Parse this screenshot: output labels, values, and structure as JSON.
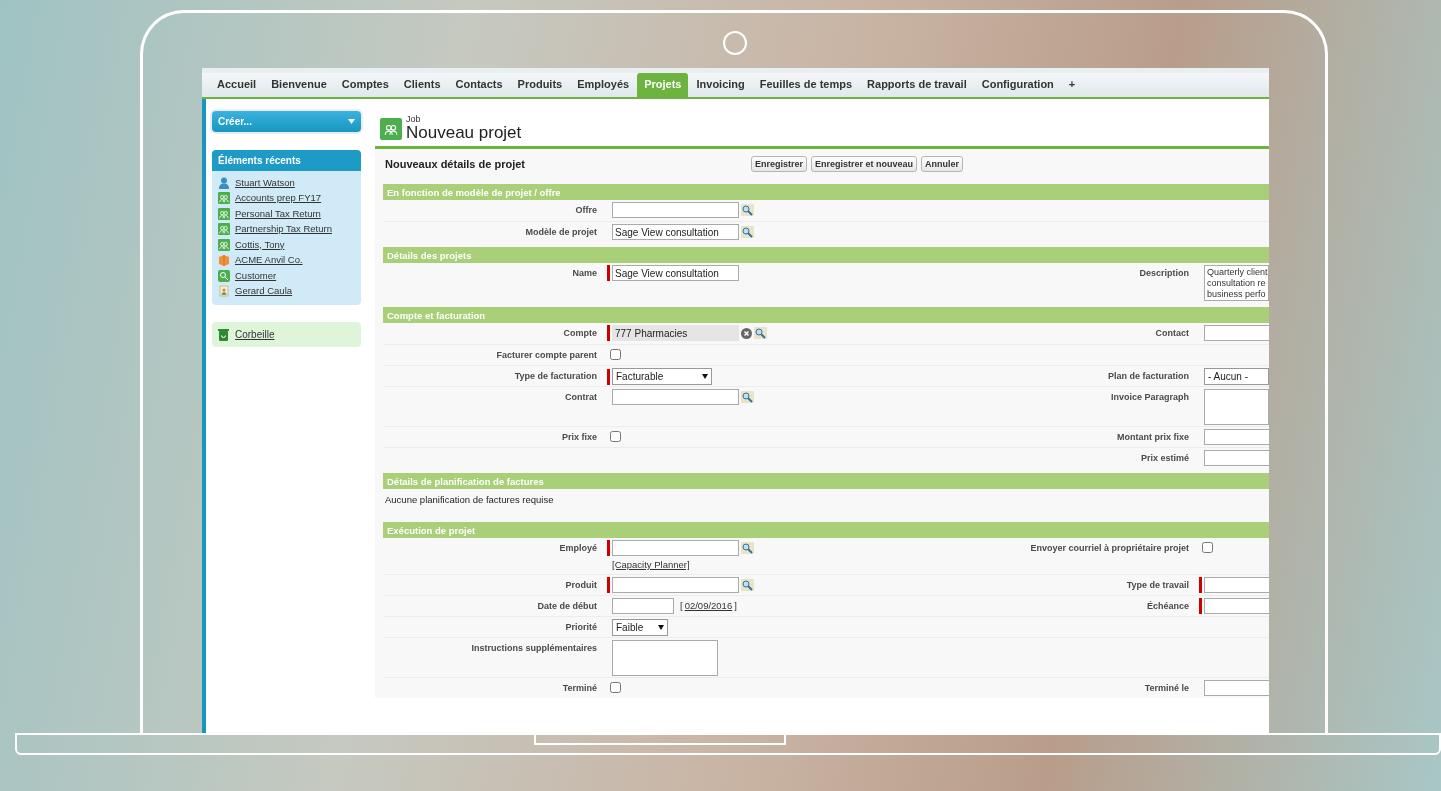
{
  "nav": {
    "tabs": [
      {
        "label": "Accueil",
        "selected": false
      },
      {
        "label": "Bienvenue",
        "selected": false
      },
      {
        "label": "Comptes",
        "selected": false
      },
      {
        "label": "Clients",
        "selected": false
      },
      {
        "label": "Contacts",
        "selected": false
      },
      {
        "label": "Produits",
        "selected": false
      },
      {
        "label": "Employés",
        "selected": false
      },
      {
        "label": "Projets",
        "selected": true
      },
      {
        "label": "Invoicing",
        "selected": false
      },
      {
        "label": "Feuilles de temps",
        "selected": false
      },
      {
        "label": "Rapports de travail",
        "selected": false
      },
      {
        "label": "Configuration",
        "selected": false
      }
    ],
    "add_tab": "+"
  },
  "sidebar": {
    "create_button": "Créer...",
    "recent": {
      "title": "Éléments récents",
      "items": [
        {
          "label": "Stuart Watson",
          "kind": "contact"
        },
        {
          "label": "Accounts prep FY17",
          "kind": "project"
        },
        {
          "label": "Personal Tax Return",
          "kind": "project"
        },
        {
          "label": "Partnership Tax Return",
          "kind": "project"
        },
        {
          "label": "Cottis, Tony",
          "kind": "project"
        },
        {
          "label": "ACME Anvil Co.",
          "kind": "account"
        },
        {
          "label": "Customer",
          "kind": "customer"
        },
        {
          "label": "Gerard Caula",
          "kind": "lead"
        }
      ]
    },
    "recycle_bin": "Corbeille"
  },
  "header": {
    "object": "Job",
    "title": "Nouveau projet"
  },
  "form": {
    "title": "Nouveaux détails de projet",
    "buttons": [
      "Enregistrer",
      "Enregistrer et nouveau",
      "Annuler"
    ],
    "sections": [
      {
        "title": "En fonction de modèle de projet / offre",
        "rows": [
          {
            "left": {
              "label": "Offre",
              "kind": "lookup",
              "required": false
            }
          },
          {
            "left": {
              "label": "Modèle de projet",
              "kind": "lookup",
              "required": false,
              "value": "Sage View consultation"
            }
          }
        ]
      },
      {
        "title": "Détails des projets",
        "rows": [
          {
            "left": {
              "label": "Name",
              "kind": "text",
              "required": true,
              "value": "Sage View consultation"
            },
            "right": {
              "label": "Description",
              "kind": "textarea",
              "required": false,
              "value": "Quarterly client\nconsultation re\nbusiness perfo"
            }
          }
        ]
      },
      {
        "title": "Compte et facturation",
        "rows": [
          {
            "left": {
              "label": "Compte",
              "kind": "locked_lookup",
              "required": true,
              "value": "777 Pharmacies"
            },
            "right": {
              "label": "Contact",
              "kind": "text",
              "required": false
            }
          },
          {
            "left": {
              "label": "Facturer compte parent",
              "kind": "checkbox",
              "checked": false
            }
          },
          {
            "left": {
              "label": "Type de facturation",
              "kind": "select",
              "required": true,
              "value": "Facturable",
              "arrow": true
            },
            "right": {
              "label": "Plan de facturation",
              "kind": "select",
              "required": false,
              "value": "- Aucun -",
              "arrow": false
            }
          },
          {
            "left": {
              "label": "Contrat",
              "kind": "lookup",
              "required": false
            },
            "right": {
              "label": "Invoice Paragraph",
              "kind": "textarea",
              "required": false
            }
          },
          {
            "left": {
              "label": "Prix fixe",
              "kind": "checkbox",
              "checked": false
            },
            "right": {
              "label": "Montant prix fixe",
              "kind": "text",
              "required": false
            }
          },
          {
            "right": {
              "label": "Prix estimé",
              "kind": "text",
              "required": false
            }
          }
        ]
      },
      {
        "title": "Détails de planification de factures",
        "message": "Aucune planification de factures requise"
      },
      {
        "title": "Exécution de projet",
        "rows": [
          {
            "left": {
              "label": "Employé",
              "kind": "lookup",
              "required": true,
              "link": "[Capacity Planner]"
            },
            "right": {
              "label": "Envoyer courriel à propriétaire projet",
              "kind": "checkbox",
              "checked": false
            }
          },
          {
            "left": {
              "label": "Produit",
              "kind": "lookup",
              "required": true
            },
            "right": {
              "label": "Type de travail",
              "kind": "text",
              "required": true
            }
          },
          {
            "left": {
              "label": "Date de début",
              "kind": "date",
              "required": false,
              "today": {
                "open": "[",
                "link": "02/09/2016",
                "close": "]"
              }
            },
            "right": {
              "label": "Échéance",
              "kind": "text",
              "required": true
            }
          },
          {
            "left": {
              "label": "Priorité",
              "kind": "select",
              "required": false,
              "value": "Faible",
              "arrow": true
            }
          },
          {
            "left": {
              "label": "Instructions supplémentaires",
              "kind": "textarea",
              "required": false
            }
          },
          {
            "left": {
              "label": "Terminé",
              "kind": "checkbox",
              "checked": false
            },
            "right": {
              "label": "Terminé le",
              "kind": "text",
              "required": false
            }
          }
        ]
      }
    ]
  }
}
